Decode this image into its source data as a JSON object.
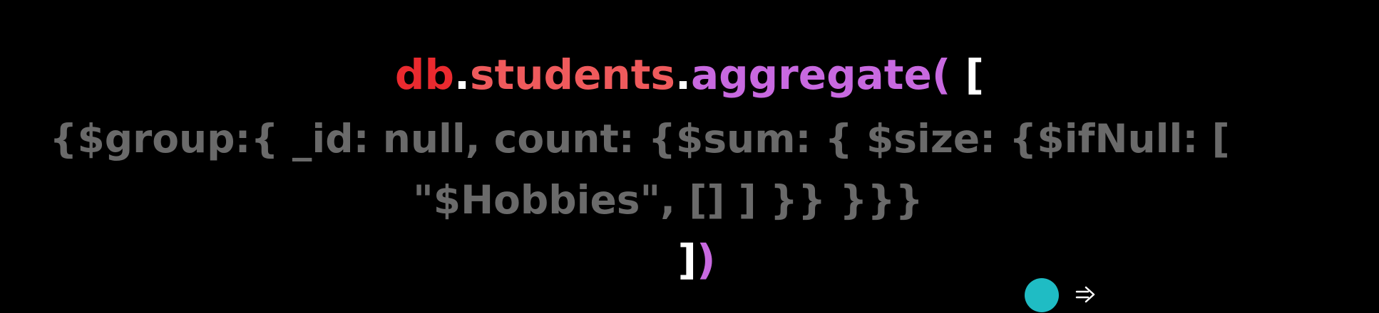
{
  "code": {
    "line1": {
      "db": "db",
      "dot1": ".",
      "students": "students",
      "dot2": ".",
      "aggregate": "aggregate",
      "paren_open": "(",
      "bracket_open": " ["
    },
    "line2": "{$group:{ _id: null, count: {$sum: { $size: {$ifNull: [",
    "line3": "\"$Hobbies\", [] ] }} }}}",
    "line4": {
      "bracket_close": "]",
      "paren_close": ")"
    }
  },
  "colors": {
    "db": "#ea2a2f",
    "students": "#ef5a5c",
    "aggregate": "#c869e0",
    "code_body": "#6a6a6a",
    "indicator": "#1fbcc4"
  },
  "icons": {
    "indicator": "circle-indicator",
    "arrow": "arrow-right-icon"
  }
}
